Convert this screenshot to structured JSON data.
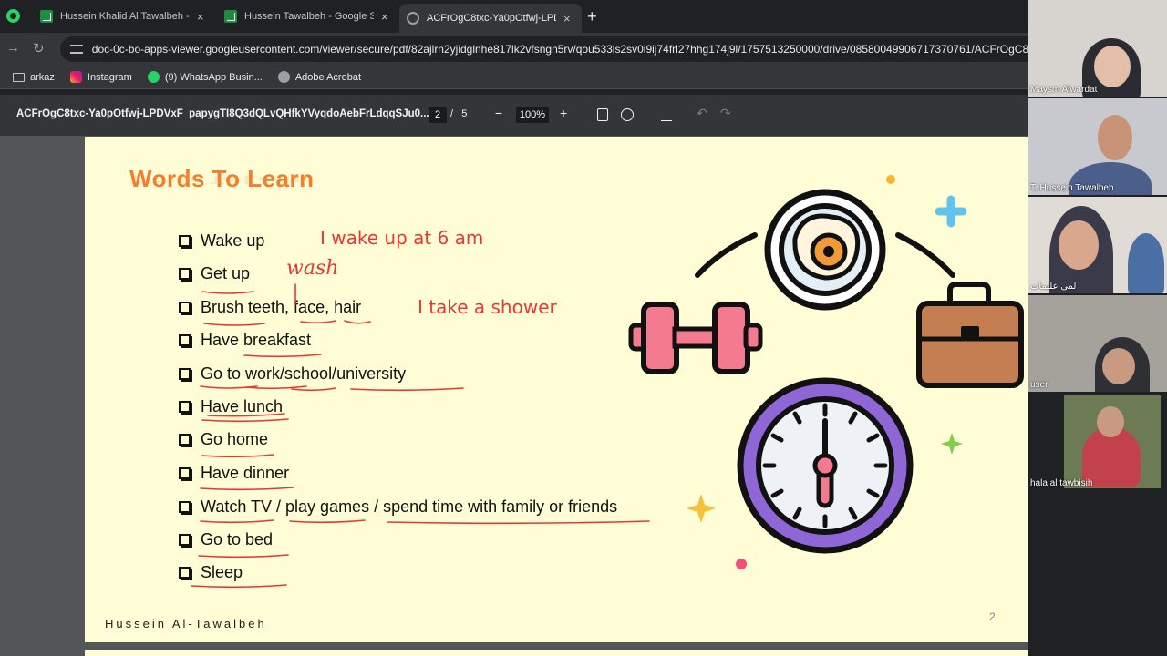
{
  "browser": {
    "tabs": [
      {
        "label": "Hussein Khalid Al Tawalbeh - Go",
        "active": false
      },
      {
        "label": "Hussein Tawalbeh - Google Shee",
        "active": false
      },
      {
        "label": "ACFrOgC8txc-Ya0pOtfwj-LPDVxF",
        "active": true
      }
    ],
    "close_glyph": "×",
    "new_tab_glyph": "+",
    "url": "doc-0c-bo-apps-viewer.googleusercontent.com/viewer/secure/pdf/82ajlrn2yjidglnhe817lk2vfsngn5rv/qou533ls2sv0i9ij74frl27hhg174j9l/1757513250000/drive/08580049906717370761/ACFrOgC8txc",
    "bookmarks": [
      "arkaz",
      "Instagram",
      "(9) WhatsApp Busin...",
      "Adobe Acrobat"
    ]
  },
  "pdf_toolbar": {
    "filename": "ACFrOgC8txc-Ya0pOtfwj-LPDVxF_papygTI8Q3dQLvQHfkYVyqdoAebFrLdqqSJu0...",
    "current_page": "2",
    "page_separator": "/",
    "total_pages": "5",
    "zoom": "100%",
    "zoom_out_glyph": "−",
    "zoom_in_glyph": "+"
  },
  "slide": {
    "title": "Words To Learn",
    "items": [
      "Wake up",
      "Get up",
      "Brush teeth, face, hair",
      "Have breakfast",
      "Go to work/school/university",
      "Have lunch",
      "Go home",
      "Have dinner",
      "Watch TV / play games / spend time with family or friends",
      "Go to bed",
      "Sleep"
    ],
    "annotations": {
      "wake": "I wake up at 6 am",
      "wash": "wash",
      "shower": "I take a shower"
    },
    "footer": "Hussein Al-Tawalbeh",
    "page_number": "2"
  },
  "participants": [
    "Maysm Alwardat",
    "T. Hussein Tawalbeh",
    "لمى عليمات",
    "user",
    "hala al tawbisih"
  ],
  "colors": {
    "slide_bg": "#fefdd5",
    "title": "#f07f2f",
    "ink": "#e53935"
  }
}
